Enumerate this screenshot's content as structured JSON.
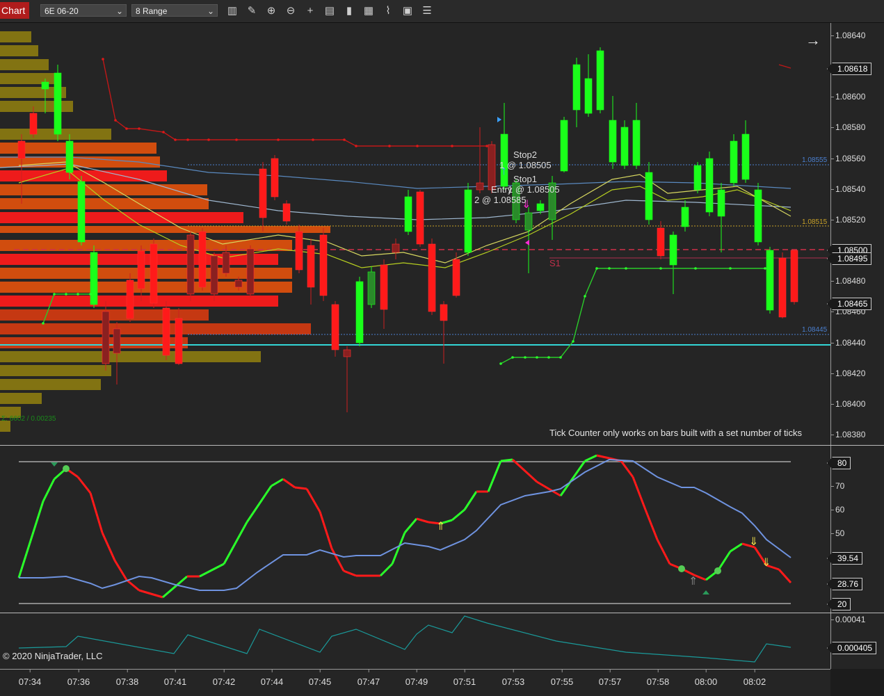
{
  "toolbar": {
    "chart_tab": "Chart",
    "instrument": "6E 06-20",
    "bar_type": "8 Range",
    "tools": [
      "bars-icon",
      "pencil-icon",
      "zoom-in-icon",
      "zoom-out-icon",
      "crosshair-icon",
      "data-box-icon",
      "bar-chart-icon",
      "chart-trader-icon",
      "strategy-icon",
      "properties-icon",
      "list-icon"
    ]
  },
  "price_panel": {
    "axis_ticks": [
      "1.08640",
      "1.08620",
      "1.08600",
      "1.08580",
      "1.08560",
      "1.08540",
      "1.08520",
      "1.08500",
      "1.08480",
      "1.08460",
      "1.08440",
      "1.08420",
      "1.08400",
      "1.08380"
    ],
    "flags": {
      "last_high": "1.08618",
      "current": "1.08500",
      "level_495": "1.08495",
      "low_last": "1.08465"
    },
    "line_labels": {
      "blue_top": "1.08555",
      "gold": "1.08515",
      "blue_bottom": "1.08445"
    },
    "order_labels": {
      "stop2": "Stop2",
      "stop2_qty": "1 @ 1.08505",
      "stop1": "Stop1",
      "entry": "Entry",
      "entry_qty": "1 @ 1.08505",
      "target_qty": "2 @ 1.08585"
    },
    "pivot_label": "S1",
    "profile_label": "Σ: 6602 / 0.00235",
    "tick_counter_message": "Tick Counter only works on bars built with a set number of ticks",
    "colors": {
      "up": "#1aff1a",
      "down": "#ff1a1a",
      "cyan_line": "#33d6d6",
      "gold_line": "#c9a227",
      "blue_line": "#4a7fd0"
    }
  },
  "oscillator_panel": {
    "axis_ticks": [
      "80",
      "70",
      "60",
      "50",
      "20"
    ],
    "flags": {
      "upper": "80",
      "value_a": "39.54",
      "value_b": "28.76",
      "lower": "20"
    }
  },
  "volatility_panel": {
    "axis_ticks": [
      "0.00041"
    ],
    "flags": {
      "current": "0.000405"
    },
    "copyright": "© 2020 NinjaTrader, LLC"
  },
  "time_axis": [
    "07:34",
    "07:36",
    "07:38",
    "07:41",
    "07:42",
    "07:44",
    "07:45",
    "07:47",
    "07:49",
    "07:51",
    "07:53",
    "07:55",
    "07:57",
    "07:58",
    "08:00",
    "08:02"
  ],
  "nav": {
    "arrow_icon": "arrow-right-icon"
  }
}
